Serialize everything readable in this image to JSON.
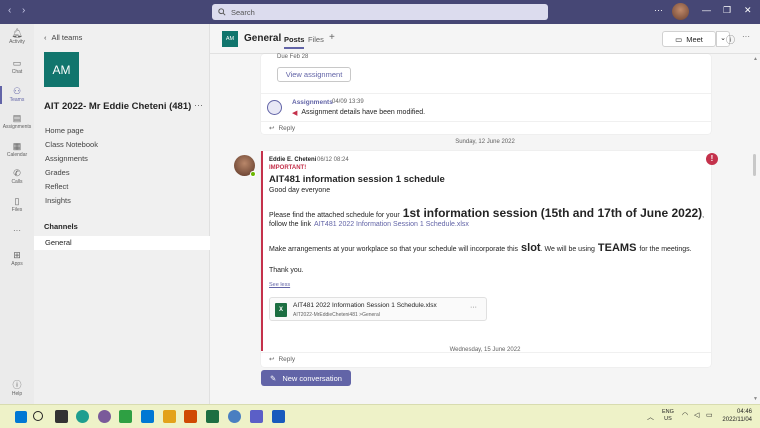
{
  "topbar": {
    "back": "‹",
    "forward": "›",
    "search_placeholder": "Search",
    "more": "···",
    "win_min": "—",
    "win_max": "❐",
    "win_close": "✕"
  },
  "rail": [
    {
      "label": "Activity",
      "icon": "bell-icon"
    },
    {
      "label": "Chat",
      "icon": "chat-icon"
    },
    {
      "label": "Teams",
      "icon": "teams-icon"
    },
    {
      "label": "Assignments",
      "icon": "assignments-icon"
    },
    {
      "label": "Calendar",
      "icon": "calendar-icon"
    },
    {
      "label": "Calls",
      "icon": "phone-icon"
    },
    {
      "label": "Files",
      "icon": "file-icon"
    },
    {
      "label": "···",
      "icon": "more-icon"
    },
    {
      "label": "Apps",
      "icon": "apps-icon"
    },
    {
      "label": "Help",
      "icon": "help-icon"
    }
  ],
  "panel": {
    "back_label": "All teams",
    "team_initials": "AM",
    "team_name": "AIT 2022- Mr Eddie Cheteni (481)",
    "team_more": "···",
    "links": [
      "Home page",
      "Class Notebook",
      "Assignments",
      "Grades",
      "Reflect",
      "Insights"
    ],
    "channels_label": "Channels",
    "channel": "General"
  },
  "header": {
    "channel_initials": "AM",
    "channel_name": "General",
    "tabs": [
      "Posts",
      "Files"
    ],
    "add_tab": "+",
    "meet_label": "Meet",
    "meet_dropdown": "⌄"
  },
  "feed": {
    "due_text": "Due Feb 28",
    "view_assignment": "View assignment",
    "assign_author": "Assignments",
    "assign_time": "04/09 13:39",
    "assign_msg": "Assignment details have been modified.",
    "reply": "Reply",
    "date1": "Sunday, 12 June 2022",
    "post": {
      "author": "Eddie E. Cheteni",
      "time": "06/12 08:24",
      "important": "IMPORTANT!",
      "subject": "AIT481 information session 1 schedule",
      "greeting": "Good day everyone",
      "p1_pre": "Please find the attached schedule for your",
      "p1_big": "1st information session (15th and 17th of June 2022)",
      "p1_comma": ",",
      "p2_pre": "follow the link",
      "p2_link": "AIT481 2022 Information Session 1 Schedule.xlsx",
      "p3_pre": "Make arrangements at your workplace so that your schedule will incorporate this",
      "p3_slot": "slot",
      "p3_mid": ". We will be using",
      "p3_teams": "TEAMS",
      "p3_end": "for the meetings.",
      "thanks": "Thank you.",
      "see_less": "See less",
      "file_name": "AIT481 2022 Information Session 1 Schedule.xlsx",
      "file_path": "AIT2022-MrEddieCheteni481 >General",
      "file_more": "···"
    },
    "date2": "Wednesday, 15 June 2022",
    "new_conversation": "New conversation"
  },
  "taskbar": {
    "lang1": "ENG",
    "lang2": "US",
    "time": "04:46",
    "date": "2022/11/04"
  },
  "colors": {
    "brand": "#6264a7",
    "team_tile": "#11756d",
    "important": "#c4314b",
    "topbar": "#464775"
  }
}
